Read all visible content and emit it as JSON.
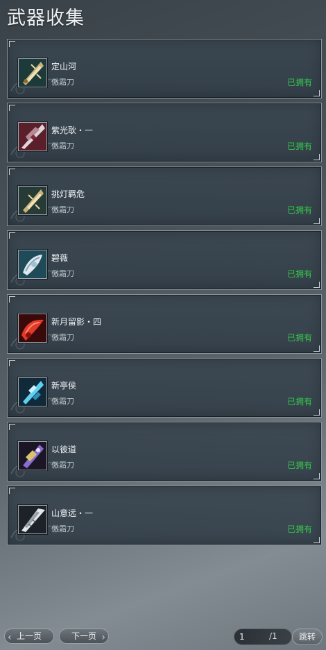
{
  "title": "武器收集",
  "weapons": [
    {
      "name": "定山河",
      "school": "傲霜刀",
      "status": "已拥有",
      "icon": "golden-ornate-blade-icon",
      "colors": [
        "#1d3a3a",
        "#c9b27a"
      ]
    },
    {
      "name": "紫光耿・一",
      "school": "傲霜刀",
      "status": "已拥有",
      "icon": "crimson-silver-blade-icon",
      "colors": [
        "#5a1f2b",
        "#e0d6da"
      ]
    },
    {
      "name": "挑灯羁危",
      "school": "傲霜刀",
      "status": "已拥有",
      "icon": "golden-ornate-blade-icon",
      "colors": [
        "#1d3a3a",
        "#c9b27a"
      ]
    },
    {
      "name": "碧薇",
      "school": "傲霜刀",
      "status": "已拥有",
      "icon": "silver-crest-blade-icon",
      "colors": [
        "#1f4a58",
        "#dfe8ee"
      ]
    },
    {
      "name": "新月留影・四",
      "school": "傲霜刀",
      "status": "已拥有",
      "icon": "red-flame-blade-icon",
      "colors": [
        "#3a0a0a",
        "#e23a2a"
      ]
    },
    {
      "name": "新亭侯",
      "school": "傲霜刀",
      "status": "已拥有",
      "icon": "blue-crystal-blade-icon",
      "colors": [
        "#102a3a",
        "#5fd0f0"
      ]
    },
    {
      "name": "以彼道",
      "school": "傲霜刀",
      "status": "已拥有",
      "icon": "purple-dark-blade-icon",
      "colors": [
        "#1a1626",
        "#8a6cd0"
      ]
    },
    {
      "name": "山意远・一",
      "school": "傲霜刀",
      "status": "已拥有",
      "icon": "white-broad-blade-icon",
      "colors": [
        "#1c2228",
        "#e4e8ea"
      ]
    }
  ],
  "pager": {
    "prev_label": "上一页",
    "next_label": "下一页",
    "page_value": "1",
    "total": "/1",
    "jump_label": "跳转"
  }
}
